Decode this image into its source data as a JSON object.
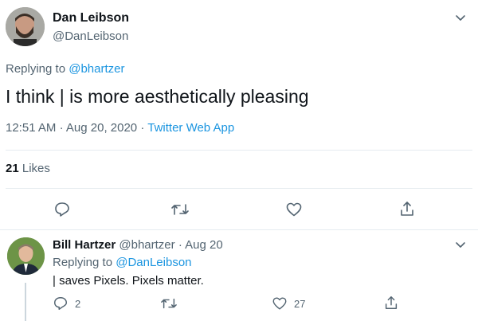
{
  "main_tweet": {
    "author_name": "Dan Leibson",
    "author_handle": "@DanLeibson",
    "replying_prefix": "Replying to",
    "replying_to": "@bhartzer",
    "text": "I think | is more aesthetically pleasing",
    "time": "12:51 AM",
    "sep1": "·",
    "date": "Aug 20, 2020",
    "sep2": "·",
    "source": "Twitter Web App",
    "likes_count": "21",
    "likes_label": "Likes"
  },
  "reply_tweet": {
    "author_name": "Bill Hartzer",
    "author_handle": "@bhartzer",
    "sep": "·",
    "date": "Aug 20",
    "replying_prefix": "Replying to",
    "replying_to": "@DanLeibson",
    "text": "| saves Pixels. Pixels matter.",
    "reply_count": "2",
    "like_count": "27"
  },
  "icons": {
    "reply": "reply-icon",
    "retweet": "retweet-icon",
    "like": "heart-icon",
    "share": "share-icon",
    "more": "chevron-down-icon"
  },
  "colors": {
    "link": "#1b95e0",
    "muted": "#536471",
    "text": "#0f1419",
    "divider": "#e6ecf0"
  }
}
